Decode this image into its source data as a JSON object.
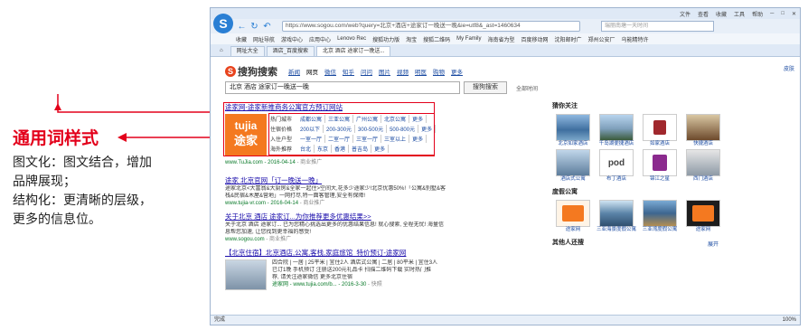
{
  "annotation": {
    "title": "通用词样式",
    "lines": [
      "图文化：图文结合，增加",
      "品牌展现；",
      "结构化：更清晰的层级，",
      "更多的信息位。"
    ]
  },
  "browser": {
    "title_menu": [
      "文件",
      "查看",
      "收藏",
      "工具",
      "帮助"
    ],
    "url": "https://www.sogou.com/web?query=北京+酒店+途家订一晚送一晚&ie=utf8&_ast=1460634",
    "search_placeholder": "瑞丽南塘一天时间",
    "bookmarks": [
      "收藏",
      "网址导航",
      "游戏中心",
      "应用中心",
      "Lenovo Rec",
      "搜狐功力版",
      "淘宝",
      "搜狐二维码",
      "My Family",
      "海南省为型",
      "百度移动网",
      "沈阳邮时广",
      "郑州公安厂",
      "乌能精特许"
    ],
    "tabs": [
      "网址大全",
      "酒店_百度搜索",
      "北京 酒店 途家订一晚送..."
    ],
    "status_left": "完成",
    "status_right": "100%"
  },
  "sogou": {
    "logo_text": "搜狗搜索",
    "verticals": [
      "新闻",
      "网页",
      "微信",
      "知乎",
      "问问",
      "图片",
      "视频",
      "明医",
      "购物",
      "更多"
    ],
    "current_vertical": "网页",
    "query": "北京 酒店 途家订一晚送一晚",
    "search_button": "搜狗搜索",
    "time_filter": "全部时间",
    "skin": "皮肤"
  },
  "results": [
    {
      "title": "途家网-途家新推商务公寓官方预订网站",
      "card": {
        "logo_top": "tujia",
        "logo_bottom": "途家",
        "rows": [
          {
            "label": "热门城市",
            "options": [
              "成都公寓",
              "三亚公寓",
              "广州公寓",
              "北京公寓",
              "更多"
            ]
          },
          {
            "label": "住宿价格",
            "options": [
              "200以下",
              "200-300元",
              "300-500元",
              "500-800元",
              "更多"
            ]
          },
          {
            "label": "入住户型",
            "options": [
              "一室一厅",
              "二室一厅",
              "三室一厅",
              "三室以上",
              "更多"
            ]
          },
          {
            "label": "海外推荐",
            "options": [
              "台北",
              "东京",
              "香港",
              "普吉岛",
              "更多"
            ]
          }
        ]
      },
      "url": "www.TuJia.com - 2016-04-14",
      "url_extra": "- 商业推广"
    },
    {
      "title": "途家 北京官网「订一晚送一晚」",
      "lines": [
        "途家北京<大富翁&大厨房&全家一起住>空间大,花多少途家少!北京优惠50%!「公寓&别墅&客",
        "栈&民宿&木屋&营地」一网打尽,特一面客管理,安全有保障!"
      ],
      "url": "www.tujia-vr.com - 2016-04-14",
      "url_extra": "- 商业推广"
    },
    {
      "title": "关于北京 酒店 途家订...为你推荐更多优惠结果>>",
      "lines": [
        "关于北京 酒店 途家订... 已为您精心挑选出更多的优惠结果信息! 就心搜索, 全程无忧! 海量信",
        "息帮您加速, 让您找到更幸福的感受!"
      ],
      "url": "www.sogou.com",
      "url_extra": "- 商业推广"
    },
    {
      "title": "【北京住宿】北京酒店,公寓,客栈,家庭旅馆_特价预订-途家网",
      "lines": [
        "四合院 | 一居 | 25平米 | 宜住2人 酒店式公寓 | 二居 | 80平米 | 宜住3人",
        "已订1晚 手机预订 注册送200元礼品卡 扫描二维码下载 实时热门推",
        "荐, 请关注途家微信 更多北京住宿"
      ],
      "url": "途家网 - www.tujia.com/b... - 2016-3-30",
      "url_extra": "- 快照"
    }
  ],
  "sidebar": {
    "section1_title": "猜你关注",
    "section1_items": [
      "北京如家酒店",
      "千岛湖便捷酒店",
      "如家酒店",
      "快捷酒店",
      "酒店式公寓",
      "布丁酒店",
      "锦江之星",
      "西门酒店"
    ],
    "section2_title": "度假公寓",
    "section2_items": [
      "途家网",
      "三亚海景度假公寓",
      "三亚湾度假公寓",
      "途家网"
    ],
    "section3_title": "其他人还搜",
    "more": "展开"
  },
  "colors": {
    "accent_red": "#e3001b",
    "tujia_orange": "#f47920",
    "link_blue": "#1a0dab",
    "url_green": "#0a7a2a"
  }
}
